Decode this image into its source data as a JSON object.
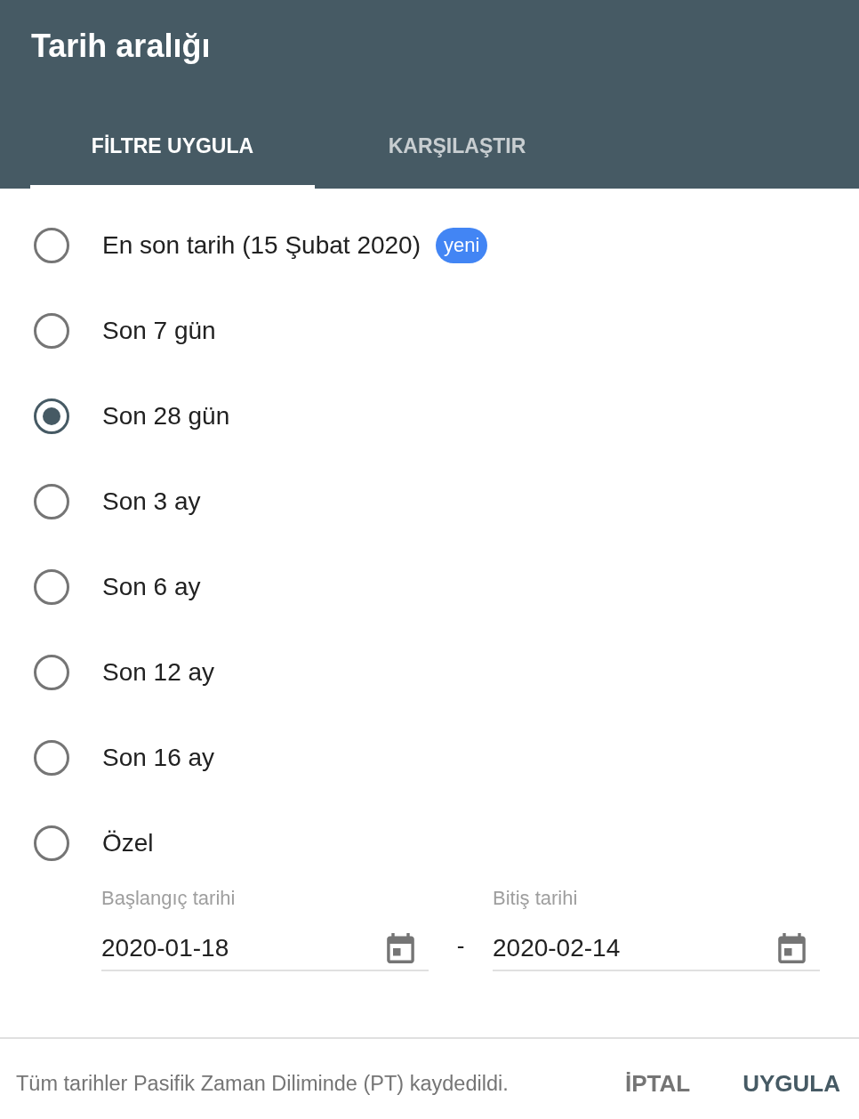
{
  "dialog": {
    "title": "Tarih aralığı"
  },
  "tabs": [
    {
      "label": "FİLTRE UYGULA",
      "selected": true
    },
    {
      "label": "KARŞILAŞTIR",
      "selected": false
    }
  ],
  "options": [
    {
      "label": "En son tarih (15 Şubat 2020)",
      "selected": false,
      "badge": "yeni"
    },
    {
      "label": "Son 7 gün",
      "selected": false
    },
    {
      "label": "Son 28 gün",
      "selected": true
    },
    {
      "label": "Son 3 ay",
      "selected": false
    },
    {
      "label": "Son 6 ay",
      "selected": false
    },
    {
      "label": "Son 12 ay",
      "selected": false
    },
    {
      "label": "Son 16 ay",
      "selected": false
    },
    {
      "label": "Özel",
      "selected": false
    }
  ],
  "custom_range": {
    "start": {
      "label": "Başlangıç tarihi",
      "value": "2020-01-18"
    },
    "separator": "-",
    "end": {
      "label": "Bitiş tarihi",
      "value": "2020-02-14"
    }
  },
  "footer": {
    "note": "Tüm tarihler Pasifik Zaman Diliminde (PT) kaydedildi.",
    "buttons": [
      {
        "label": "İPTAL",
        "kind": "secondary"
      },
      {
        "label": "UYGULA",
        "kind": "primary"
      }
    ]
  }
}
